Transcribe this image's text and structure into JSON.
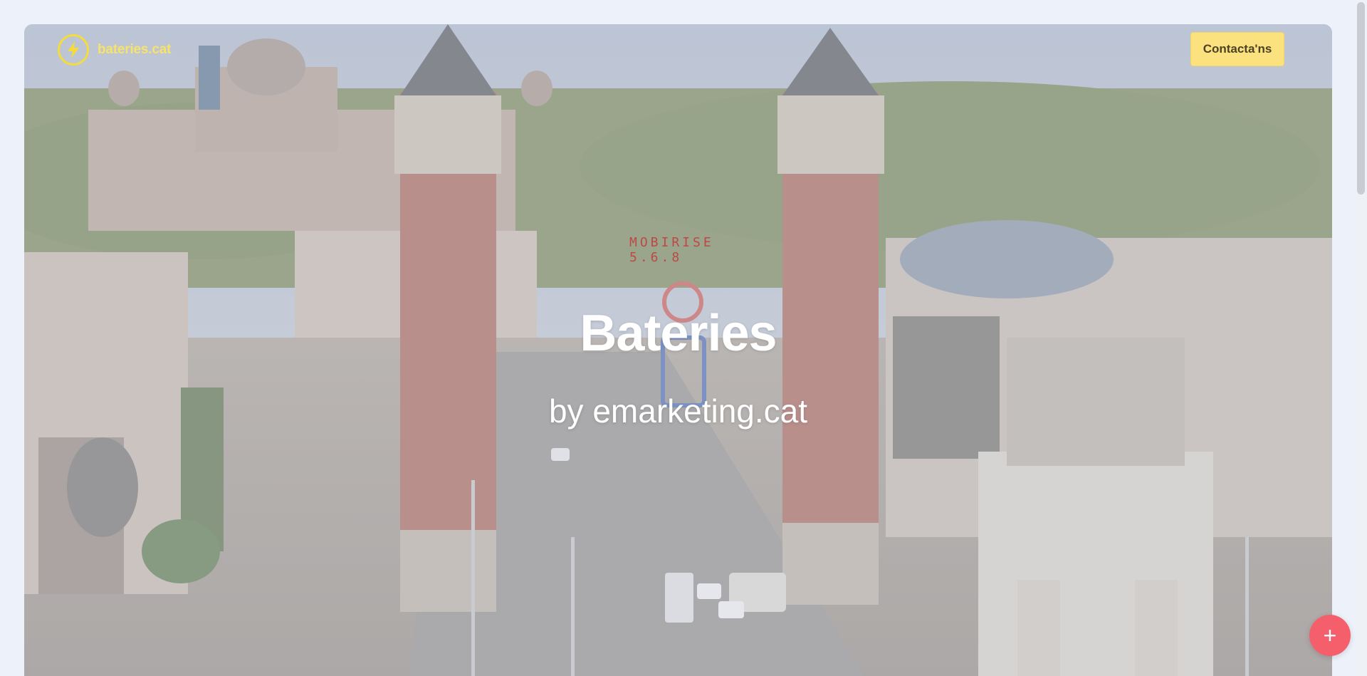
{
  "brand": {
    "name": "bateries.cat",
    "logo_icon": "lightning-icon",
    "color": "#f4dc3c"
  },
  "nav": {
    "contact_label": "Contacta'ns"
  },
  "hero": {
    "title": "Bateries",
    "subtitle": "by emarketing.cat",
    "watermark": "MOBIRISE 5.6.8"
  },
  "fab": {
    "icon": "plus-icon",
    "label": "+",
    "color": "#f55f6c"
  },
  "colors": {
    "page_bg": "#edf1f9",
    "accent": "#fbe27f"
  }
}
